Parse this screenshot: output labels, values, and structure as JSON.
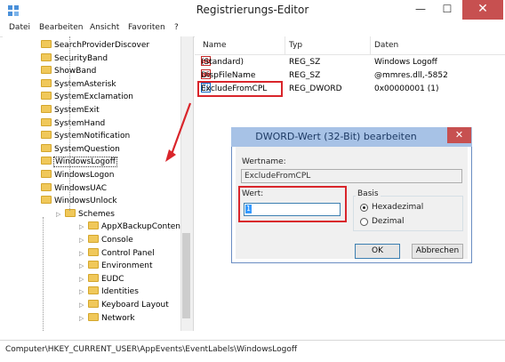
{
  "window": {
    "title": "Registrierungs-Editor",
    "min": "—",
    "max": "☐",
    "close": "✕"
  },
  "menu": [
    "Datei",
    "Bearbeiten",
    "Ansicht",
    "Favoriten",
    "?"
  ],
  "tree": {
    "items": [
      {
        "label": "SearchProviderDiscover",
        "level": 2
      },
      {
        "label": "SecurityBand",
        "level": 2
      },
      {
        "label": "ShowBand",
        "level": 2
      },
      {
        "label": "SystemAsterisk",
        "level": 2
      },
      {
        "label": "SystemExclamation",
        "level": 2
      },
      {
        "label": "SystemExit",
        "level": 2
      },
      {
        "label": "SystemHand",
        "level": 2
      },
      {
        "label": "SystemNotification",
        "level": 2
      },
      {
        "label": "SystemQuestion",
        "level": 2
      },
      {
        "label": "WindowsLogoff",
        "level": 2,
        "selected": true
      },
      {
        "label": "WindowsLogon",
        "level": 2
      },
      {
        "label": "WindowsUAC",
        "level": 2
      },
      {
        "label": "WindowsUnlock",
        "level": 2
      },
      {
        "label": "Schemes",
        "level": 1
      },
      {
        "label": "AppXBackupContentType",
        "level": 0
      },
      {
        "label": "Console",
        "level": 0
      },
      {
        "label": "Control Panel",
        "level": 0
      },
      {
        "label": "Environment",
        "level": 0
      },
      {
        "label": "EUDC",
        "level": 0
      },
      {
        "label": "Identities",
        "level": 0
      },
      {
        "label": "Keyboard Layout",
        "level": 0
      },
      {
        "label": "Network",
        "level": 0
      }
    ]
  },
  "list": {
    "headers": {
      "name": "Name",
      "type": "Typ",
      "data": "Daten"
    },
    "rows": [
      {
        "name": "(Standard)",
        "type": "REG_SZ",
        "data": "Windows Logoff",
        "icon": "string-value-icon"
      },
      {
        "name": "DispFileName",
        "type": "REG_SZ",
        "data": "@mmres.dll,-5852",
        "icon": "string-value-icon"
      },
      {
        "name": "ExcludeFromCPL",
        "type": "REG_DWORD",
        "data": "0x00000001 (1)",
        "icon": "dword-value-icon"
      }
    ]
  },
  "status": {
    "path": "Computer\\HKEY_CURRENT_USER\\AppEvents\\EventLabels\\WindowsLogoff"
  },
  "dialog": {
    "title": "DWORD-Wert (32-Bit) bearbeiten",
    "close": "✕",
    "value_name_label": "Wertname:",
    "value_name": "ExcludeFromCPL",
    "value_label": "Wert:",
    "value": "1",
    "basis_label": "Basis",
    "radio_hex": "Hexadezimal",
    "radio_dec": "Dezimal",
    "ok": "OK",
    "cancel": "Abbrechen"
  },
  "colors": {
    "highlight": "#d9252b",
    "dialog_title": "#a7c2e6",
    "folder": "#f0c85a"
  }
}
